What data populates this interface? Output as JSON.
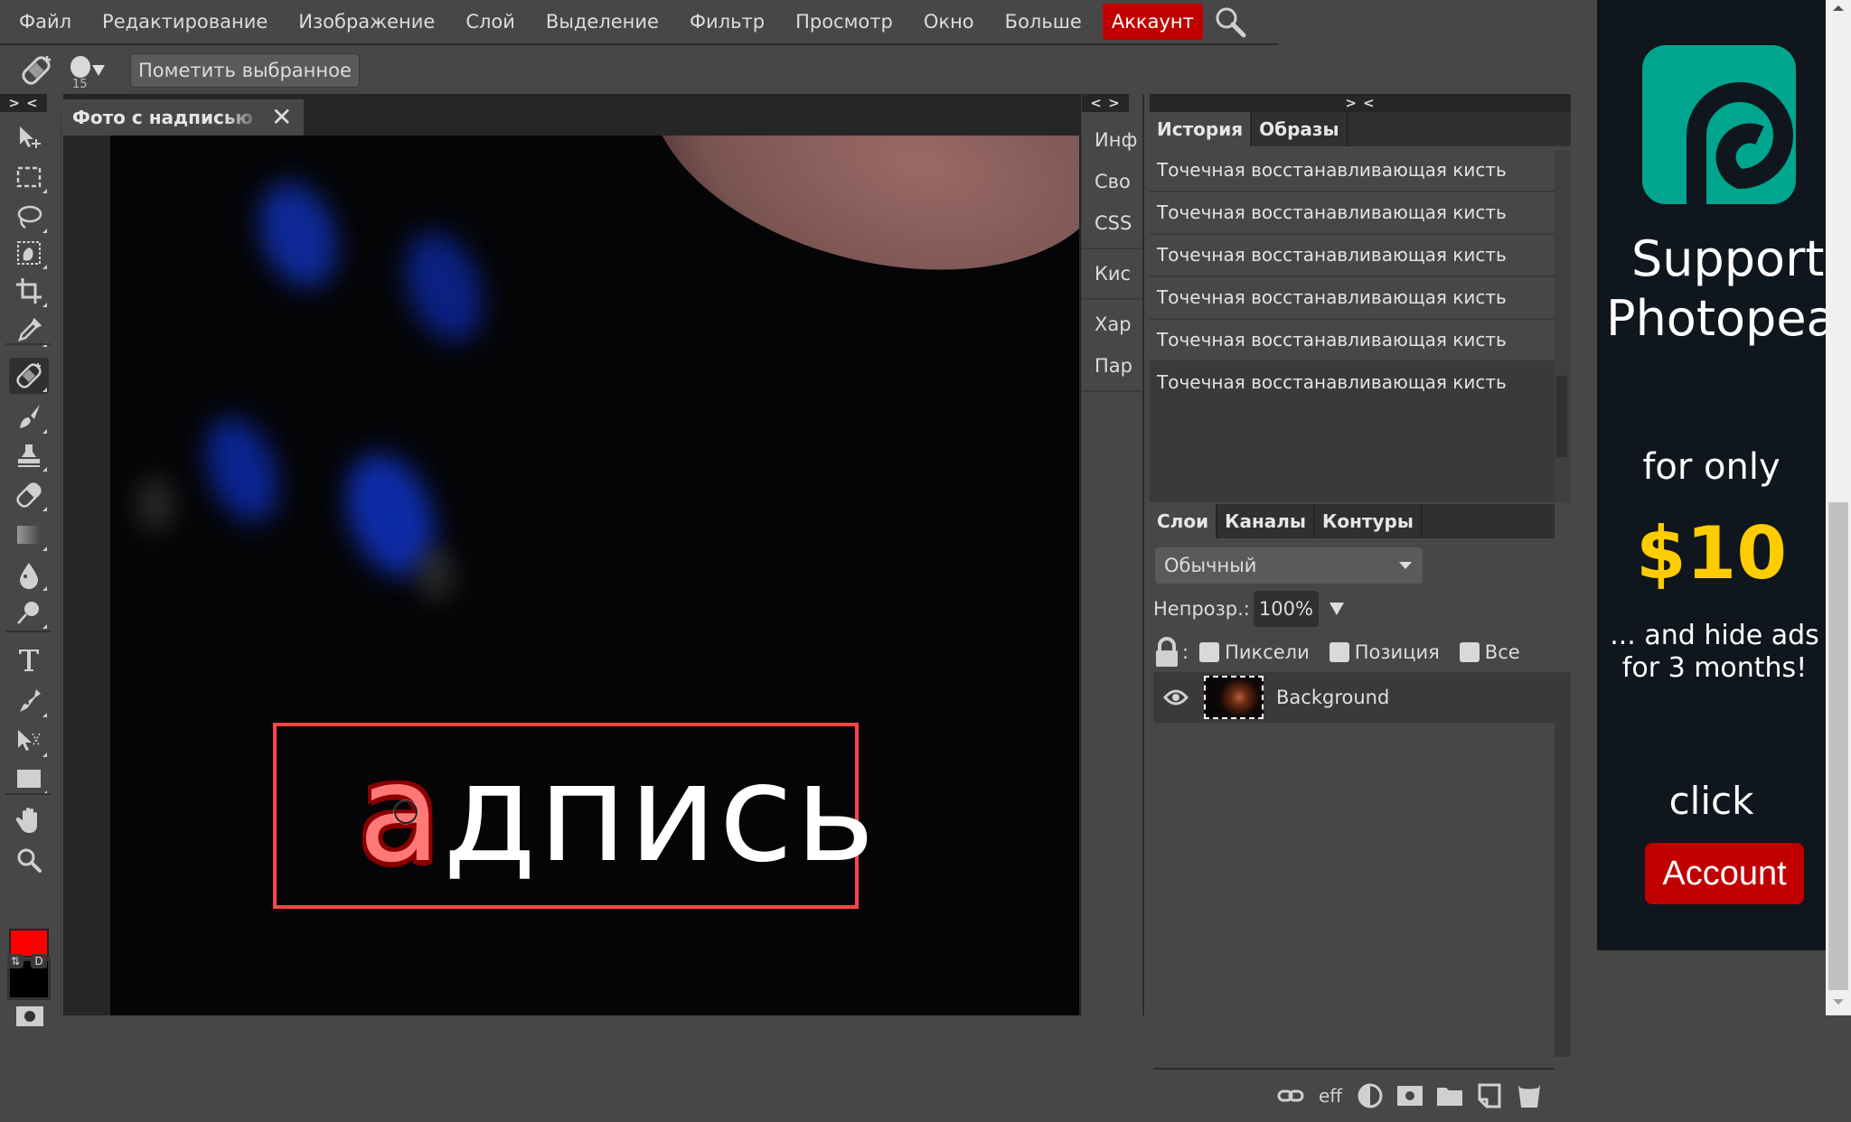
{
  "menubar": {
    "items": [
      "Файл",
      "Редактирование",
      "Изображение",
      "Слой",
      "Выделение",
      "Фильтр",
      "Просмотр",
      "Окно",
      "Больше"
    ],
    "account_label": "Аккаунт",
    "account_color": "#c00000",
    "search_icon": "search-icon"
  },
  "options_bar": {
    "tool_icon": "spot-healing-brush-icon",
    "brush_size": "15",
    "mark_selected_label": "Пометить выбранное"
  },
  "left_toolbar": {
    "collapse_label": "> <",
    "tools": [
      {
        "name": "move-tool",
        "icon": "move-icon",
        "active": false
      },
      {
        "name": "marquee-tool",
        "icon": "rect-select-icon",
        "active": false
      },
      {
        "name": "lasso-tool",
        "icon": "lasso-icon",
        "active": false
      },
      {
        "name": "quick-select-tool",
        "icon": "quick-select-icon",
        "active": false
      },
      {
        "name": "crop-tool",
        "icon": "crop-icon",
        "active": false
      },
      {
        "name": "eyedropper-tool",
        "icon": "eyedropper-icon",
        "active": false
      },
      {
        "name": "spot-healing-tool",
        "icon": "bandage-icon",
        "active": true
      },
      {
        "name": "brush-tool",
        "icon": "brush-icon",
        "active": false
      },
      {
        "name": "clone-stamp-tool",
        "icon": "stamp-icon",
        "active": false
      },
      {
        "name": "eraser-tool",
        "icon": "eraser-icon",
        "active": false
      },
      {
        "name": "gradient-tool",
        "icon": "gradient-icon",
        "active": false
      },
      {
        "name": "blur-tool",
        "icon": "drop-icon",
        "active": false
      },
      {
        "name": "dodge-tool",
        "icon": "dodge-icon",
        "active": false
      },
      {
        "name": "type-tool",
        "icon": "type-icon",
        "active": false
      },
      {
        "name": "pen-tool",
        "icon": "pen-icon",
        "active": false
      },
      {
        "name": "path-select-tool",
        "icon": "path-select-icon",
        "active": false
      },
      {
        "name": "shape-tool",
        "icon": "rectangle-icon",
        "active": false
      },
      {
        "name": "hand-tool",
        "icon": "hand-icon",
        "active": false
      },
      {
        "name": "zoom-tool",
        "icon": "zoom-icon",
        "active": false
      }
    ],
    "foreground_color": "#ff0000",
    "background_color": "#000000",
    "swap_label": "⇅",
    "default_label": "D"
  },
  "document": {
    "tab_title": "Фото с надписью",
    "close_icon": "close-icon",
    "canvas_text": "адпись",
    "canvas_text_highlight": "а",
    "canvas_text_rest": "дпись",
    "selection_color": "#ff4444"
  },
  "mini_panel": {
    "collapse_label": "< >",
    "items": [
      "Инф",
      "Сво",
      "CSS",
      "Кис",
      "Хар",
      "Пар"
    ]
  },
  "right_panel": {
    "collapse_label": "> <",
    "top_tabs": [
      {
        "label": "История",
        "active": true
      },
      {
        "label": "Образы",
        "active": false
      }
    ],
    "history": [
      "Точечная восстанавливающая кисть",
      "Точечная восстанавливающая кисть",
      "Точечная восстанавливающая кисть",
      "Точечная восстанавливающая кисть",
      "Точечная восстанавливающая кисть",
      "Точечная восстанавливающая кисть"
    ],
    "layer_tabs": [
      {
        "label": "Слои",
        "active": true
      },
      {
        "label": "Каналы",
        "active": false
      },
      {
        "label": "Контуры",
        "active": false
      }
    ],
    "blend_mode": "Обычный",
    "opacity_label": "Непрозр.:",
    "opacity_value": "100%",
    "lock_colon": ":",
    "lock_options": [
      "Пиксели",
      "Позиция",
      "Все"
    ],
    "layers": [
      {
        "name": "Background",
        "visible": true
      }
    ],
    "footer_icons": [
      "link-icon",
      "effects-icon",
      "adjustment-icon",
      "mask-icon",
      "folder-icon",
      "new-layer-icon",
      "trash-icon"
    ],
    "effects_label": "eff"
  },
  "ad": {
    "title_line1": "Support",
    "title_line2": "Photopea",
    "for_only": "for only",
    "price": "$10",
    "hide_line1": "... and hide ads",
    "hide_line2": "for 3 months!",
    "click": "click",
    "button_label": "Account",
    "logo_color": "#00a58e",
    "price_color": "#ffcc00"
  }
}
